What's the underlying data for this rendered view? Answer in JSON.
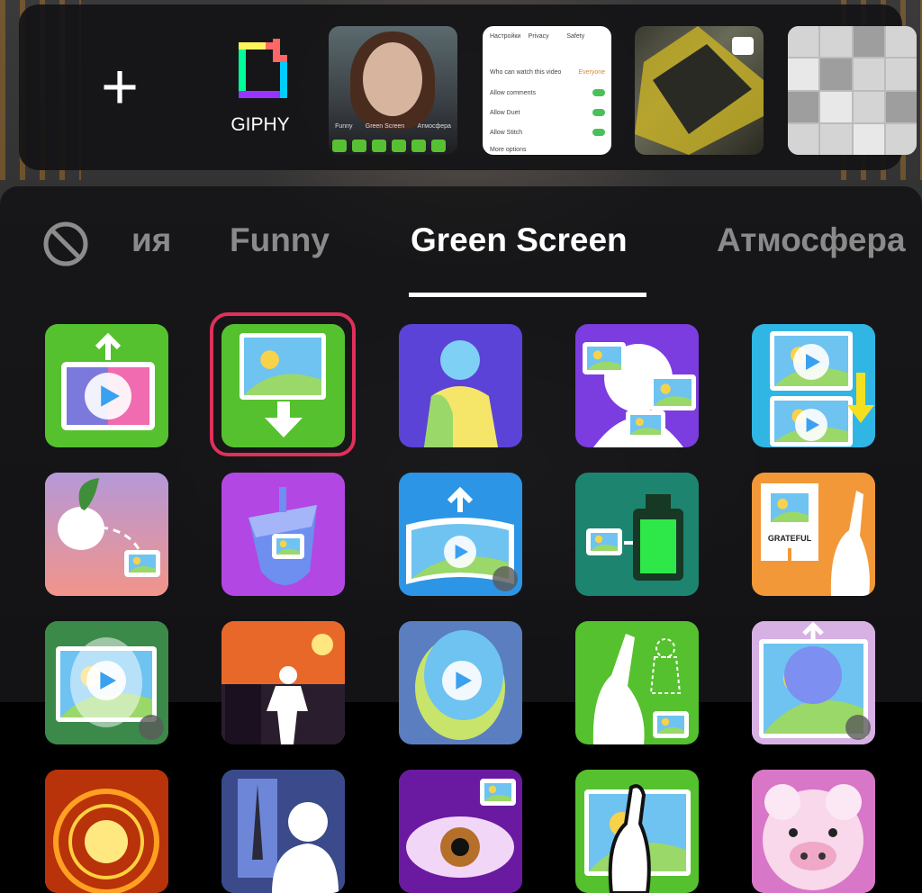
{
  "top_bar": {
    "add_label": "+",
    "giphy_label": "GIPHY",
    "thumb_green_screen": {
      "tabs": [
        "Funny",
        "Green Screen",
        "Атмосфера"
      ]
    },
    "thumb_settings": {
      "header": [
        "Настройки",
        "Privacy",
        "Safety"
      ],
      "rows": [
        "Who can watch this video",
        "Allow comments",
        "Allow Duet",
        "Allow Stitch",
        "More options"
      ],
      "value": "Everyone"
    }
  },
  "tabs": {
    "none_icon": "no-effect-icon",
    "items": [
      "ия",
      "Funny",
      "Green Screen",
      "Атмосфера"
    ],
    "active": "Green Screen"
  },
  "effects": [
    {
      "name": "upload-video-effect",
      "bg": "#55c12e"
    },
    {
      "name": "photo-background-effect",
      "bg": "#55c12e",
      "selected": true
    },
    {
      "name": "person-photo-effect",
      "bg": "#5b43d8"
    },
    {
      "name": "multi-photo-effect",
      "bg": "#7b3ce0"
    },
    {
      "name": "video-stack-effect",
      "bg": "#2fb6e4"
    },
    {
      "name": "radish-effect",
      "bg": "#c89ec8"
    },
    {
      "name": "dreidel-photo-effect",
      "bg": "#b347e4"
    },
    {
      "name": "panorama-video-effect",
      "bg": "#2c95e6"
    },
    {
      "name": "lantern-effect",
      "bg": "#1d8470"
    },
    {
      "name": "grateful-effect",
      "bg": "#f39838",
      "label": "GRATEFUL"
    },
    {
      "name": "oval-video-effect",
      "bg": "#8a8a8a"
    },
    {
      "name": "halloween-effect",
      "bg": "#e0602a"
    },
    {
      "name": "egg-video-effect",
      "bg": "#5a7ec0"
    },
    {
      "name": "wave-outline-effect",
      "bg": "#55c12e"
    },
    {
      "name": "double-video-effect",
      "bg": "#b19bd8"
    },
    {
      "name": "fire-ring-effect",
      "bg": "#e86a1a"
    },
    {
      "name": "tower-effect",
      "bg": "#5a6cb0"
    },
    {
      "name": "eye-effect",
      "bg": "#a93ad8"
    },
    {
      "name": "hand-photo-effect",
      "bg": "#55c12e"
    },
    {
      "name": "pig-face-effect",
      "bg": "#e890c8"
    }
  ],
  "colors": {
    "selection": "#e0305a",
    "active_tab": "#ffffff",
    "inactive_tab": "#8a8a8a",
    "green": "#55c12e"
  }
}
